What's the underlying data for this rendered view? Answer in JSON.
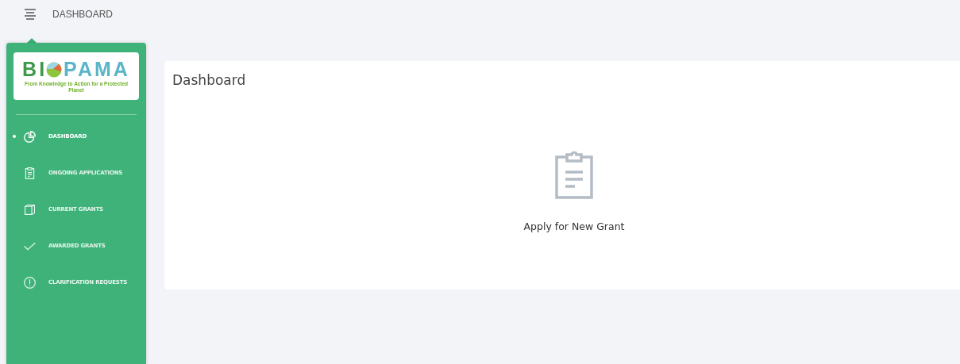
{
  "topbar": {
    "title": "DASHBOARD"
  },
  "sidebar": {
    "logo": {
      "left": "BI",
      "right": "PAMA",
      "tagline": "From Knowledge to Action for a Protected Planet"
    },
    "items": [
      {
        "label": "DASHBOARD",
        "kind": "pie",
        "selected": true
      },
      {
        "label": "ONGOING APPLICATIONS",
        "kind": "clipboard",
        "selected": false
      },
      {
        "label": "CURRENT GRANTS",
        "kind": "box",
        "selected": false
      },
      {
        "label": "AWARDED GRANTS",
        "kind": "check",
        "selected": false
      },
      {
        "label": "CLARIFICATION REQUESTS",
        "kind": "alert",
        "selected": false
      }
    ]
  },
  "card": {
    "title": "Dashboard",
    "action": "Apply for New Grant"
  }
}
